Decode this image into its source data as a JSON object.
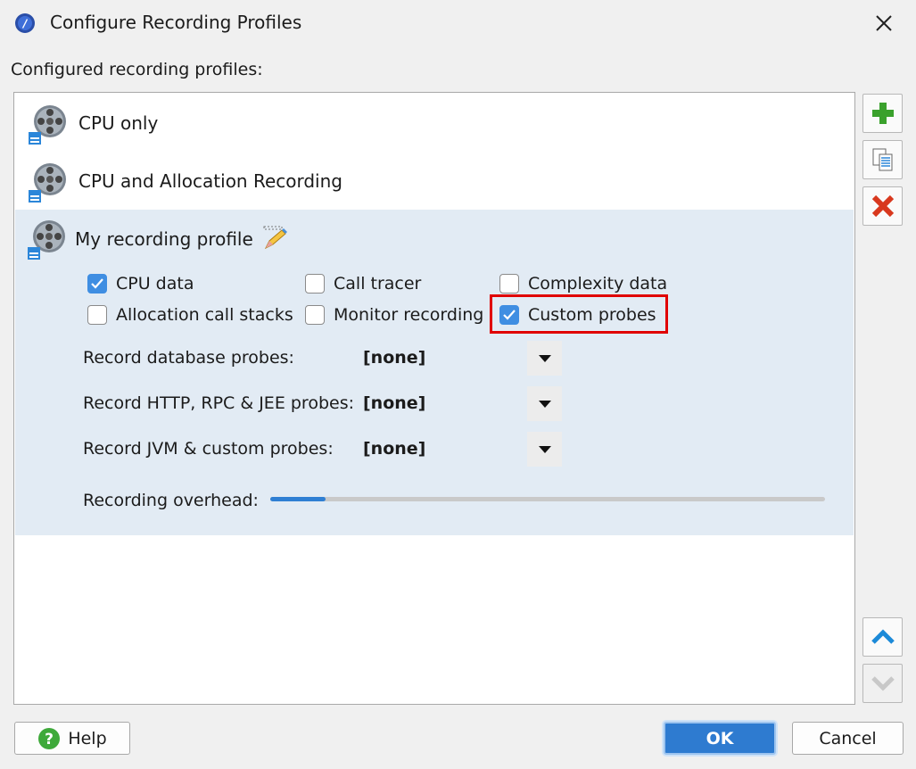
{
  "window": {
    "title": "Configure Recording Profiles"
  },
  "section_label": "Configured recording profiles:",
  "profiles": [
    {
      "label": "CPU only"
    },
    {
      "label": "CPU and Allocation Recording"
    },
    {
      "label": "My recording profile"
    }
  ],
  "options": {
    "cpu_data": {
      "label": "CPU data",
      "checked": true
    },
    "call_tracer": {
      "label": "Call tracer",
      "checked": false
    },
    "complexity_data": {
      "label": "Complexity data",
      "checked": false
    },
    "allocation_call_stacks": {
      "label": "Allocation call stacks",
      "checked": false
    },
    "monitor_recording": {
      "label": "Monitor recording",
      "checked": false
    },
    "custom_probes": {
      "label": "Custom probes",
      "checked": true
    }
  },
  "probes": [
    {
      "label": "Record database probes:",
      "value": "[none]"
    },
    {
      "label": "Record HTTP, RPC & JEE probes:",
      "value": "[none]"
    },
    {
      "label": "Record JVM & custom probes:",
      "value": "[none]"
    }
  ],
  "overhead": {
    "label": "Recording overhead:",
    "level": 0.1
  },
  "buttons": {
    "help": "Help",
    "ok": "OK",
    "cancel": "Cancel"
  },
  "colors": {
    "accent": "#2e7bd0",
    "highlight": "#e00000",
    "selection": "#e2ebf4"
  },
  "icons": [
    "app-icon",
    "close-icon",
    "film-reel-icon",
    "edit-pencil-icon",
    "add-icon",
    "copy-icon",
    "delete-icon",
    "move-up-icon",
    "move-down-icon",
    "help-icon",
    "dropdown-arrow-icon",
    "checkmark-icon"
  ]
}
